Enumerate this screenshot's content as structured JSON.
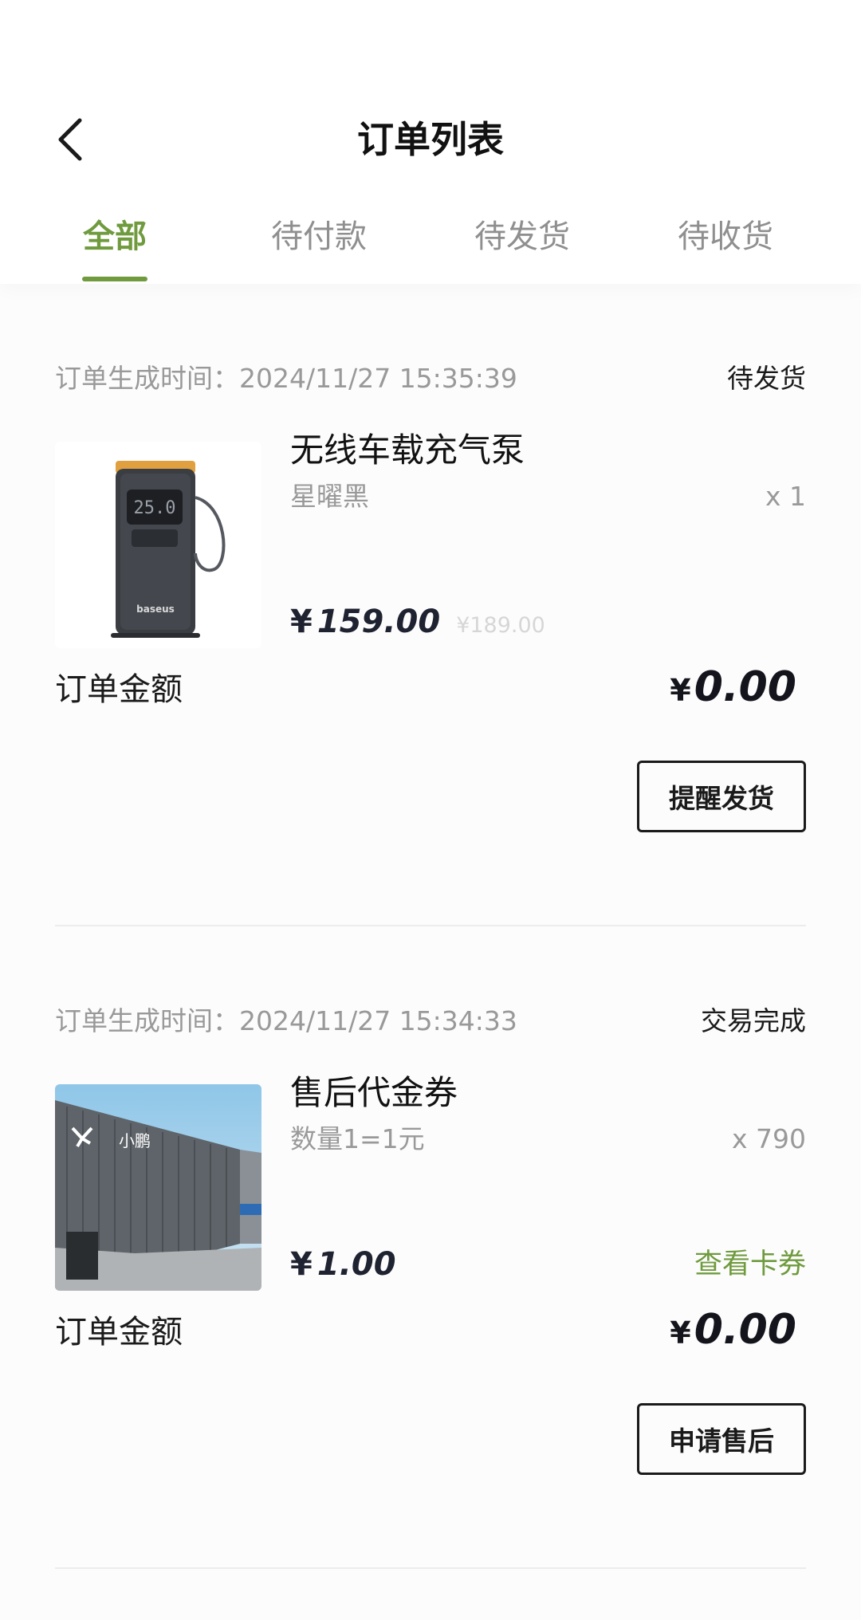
{
  "header": {
    "title": "订单列表",
    "back_icon": "chevron-left-icon"
  },
  "tabs": [
    {
      "label": "全部",
      "active": true
    },
    {
      "label": "待付款",
      "active": false
    },
    {
      "label": "待发货",
      "active": false
    },
    {
      "label": "待收货",
      "active": false
    }
  ],
  "orders": [
    {
      "time": "订单生成时间：2024/11/27 15:35:39",
      "status": "待发货",
      "product": {
        "name": "无线车载充气泵",
        "spec": "星曜黑",
        "qty": "x 1",
        "price_currency": "¥",
        "price": "159.00",
        "original_price": "¥189.00",
        "image": "tire-inflator-image"
      },
      "total_label": "订单金额",
      "total_currency": "¥",
      "total": "0.00",
      "action": "提醒发货"
    },
    {
      "time": "订单生成时间：2024/11/27 15:34:33",
      "status": "交易完成",
      "product": {
        "name": "售后代金券",
        "spec": "数量1=1元",
        "qty": "x 790",
        "price_currency": "¥",
        "price": "1.00",
        "link": "查看卡券",
        "image": "service-center-building-image",
        "logo_text": "小鹏"
      },
      "total_label": "订单金额",
      "total_currency": "¥",
      "total": "0.00",
      "action": "申请售后"
    }
  ],
  "colors": {
    "accent": "#6f9a3d",
    "muted": "#999999",
    "text": "#1a1a1a"
  }
}
